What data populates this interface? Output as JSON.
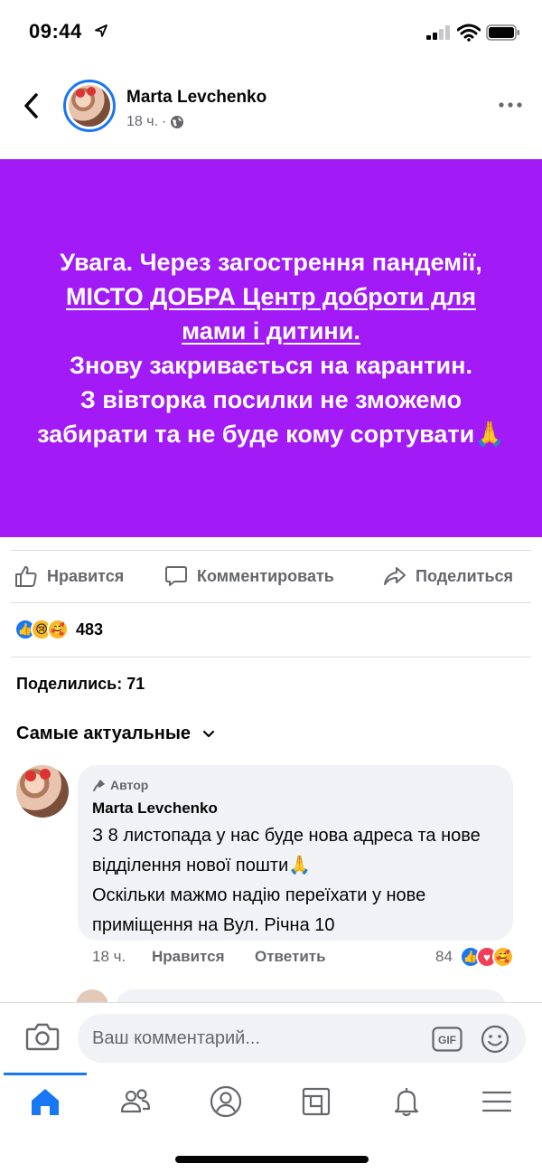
{
  "status_bar": {
    "time": "09:44"
  },
  "post": {
    "author": "Marta Levchenko",
    "time": "18 ч.",
    "meta_separator": "·",
    "text_before_link": "Увага. Через загострення пандемії, ",
    "text_link": "МІСТО ДОБРА Центр доброти для мами і дитини.",
    "text_after_link": "Знову закривається на карантин.",
    "text_line_last": "З вівторка посилки не зможемо забирати та не буде кому сортувати🙏",
    "background_color": "#a21af5"
  },
  "actions": {
    "like": "Нравится",
    "comment": "Комментировать",
    "share": "Поделиться"
  },
  "reactions": {
    "count": "483"
  },
  "shares": "Поделились: 71",
  "sort_label": "Самые актуальные",
  "comment": {
    "badge": "Автор",
    "author": "Marta Levchenko",
    "text_1": "З 8 листопада у нас буде нова адреса та нове відділення нової пошти🙏",
    "text_2": "Оскільки мажмо надію переїхати у нове приміщення на Вул. Річна 10",
    "time": "18 ч.",
    "like": "Нравится",
    "reply": "Ответить",
    "reaction_count": "84"
  },
  "composer": {
    "placeholder": "Ваш комментарий..."
  },
  "colors": {
    "accent": "#1877f2",
    "secondary_text": "#65676b"
  }
}
